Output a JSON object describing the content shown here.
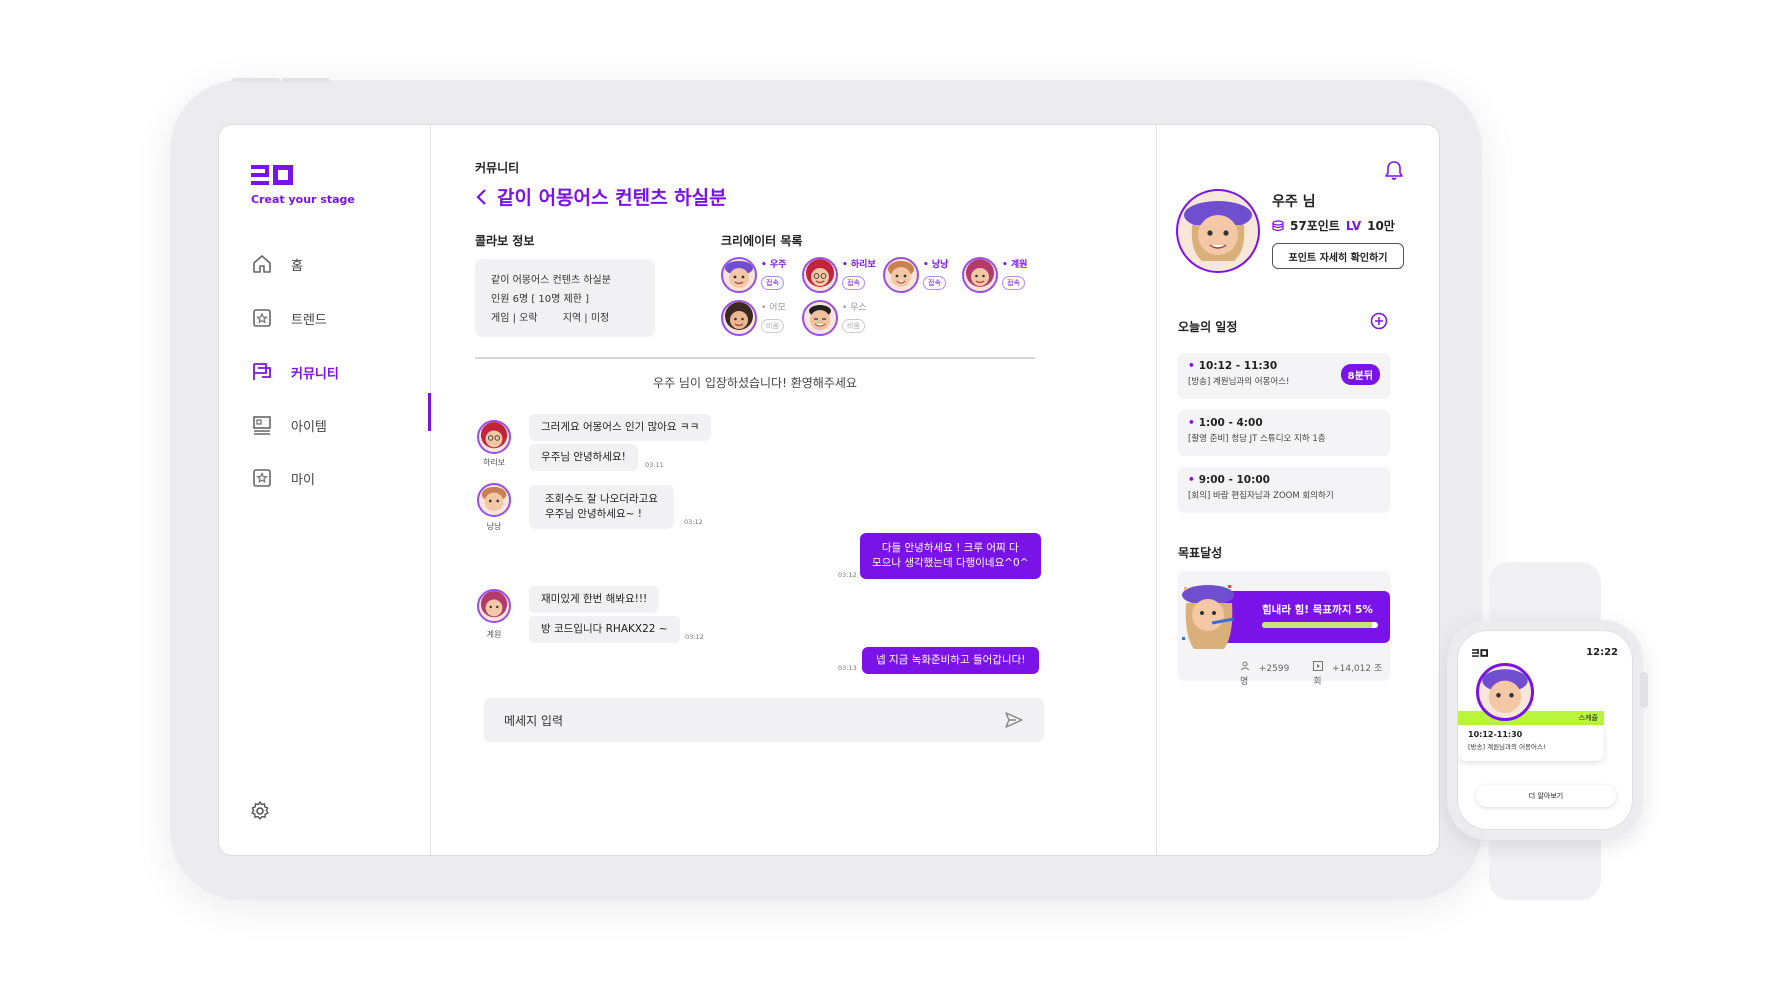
{
  "brand": {
    "tagline": "Creat your stage",
    "accent": "#7a13e8"
  },
  "sidebar": {
    "items": [
      {
        "label": "홈",
        "icon": "home-icon"
      },
      {
        "label": "트렌드",
        "icon": "trend-icon"
      },
      {
        "label": "커뮤니티",
        "icon": "community-icon",
        "active": true
      },
      {
        "label": "아이템",
        "icon": "item-icon"
      },
      {
        "label": "마이",
        "icon": "my-icon"
      }
    ],
    "settings_icon": "gear-icon"
  },
  "main": {
    "breadcrumb": "커뮤니티",
    "title": "같이 어몽어스 컨텐츠 하실분",
    "collab": {
      "title": "콜라보 정보",
      "line1": "같이 어몽어스 컨텐츠 하실분",
      "line2": "인원 6명 [ 10명 제한 ]",
      "line3a": "게임 | 오락",
      "line3b": "지역 | 미정"
    },
    "creators": {
      "title": "크리에이터 목록",
      "list": [
        {
          "name": "• 우주",
          "status": "접속"
        },
        {
          "name": "• 하리보",
          "status": "접속"
        },
        {
          "name": "• 낭낭",
          "status": "접속"
        },
        {
          "name": "• 계원",
          "status": "접속"
        },
        {
          "name": "• 어모",
          "status": "비움"
        },
        {
          "name": "• 우스",
          "status": "비움"
        }
      ]
    },
    "system_msg": "우주 님이 입장하셨습니다! 환영해주세요",
    "messages": [
      {
        "sender": "하리보",
        "text": "그러게요 어몽어스 인기 많아요 ㅋㅋ"
      },
      {
        "sender": "하리보",
        "text": "우주님 안녕하세요!",
        "time": "03:11"
      },
      {
        "sender": "낭낭",
        "text1": "조회수도 잘 나오더라고요",
        "text2": "우주님 안녕하세요~ !",
        "time": "03:12"
      },
      {
        "sender": "me",
        "text1": "다들 안녕하세요 ! 크루 어찌 다",
        "text2": "모으나 생각했는데 다행이네요^0^",
        "time": "03:12"
      },
      {
        "sender": "계원",
        "text": "재미있게 한번 해봐요!!!"
      },
      {
        "sender": "계원",
        "text": "방 코드입니다 RHAKX22 ~",
        "time": "03:12"
      },
      {
        "sender": "me",
        "text": "넵 지금 녹화준비하고 들어갑니다!",
        "time": "03:13"
      }
    ],
    "input_placeholder": "메세지 입력"
  },
  "right": {
    "user_name": "우주 님",
    "points": "57포인트",
    "level_label": "LV",
    "level_value": "10만",
    "points_button": "포인트 자세히 확인하기",
    "schedule_title": "오늘의 일정",
    "schedule": [
      {
        "time": "10:12 - 11:30",
        "desc": "[방송] 계원님과의 어몽어스!",
        "badge": "8분뒤"
      },
      {
        "time": "1:00 - 4:00",
        "desc": "[촬영 준비] 청담 JT 스튜디오 지하 1층"
      },
      {
        "time": "9:00 - 10:00",
        "desc": "[회의] 바람 편집자님과 ZOOM 회의하기"
      }
    ],
    "goal_title": "목표달성",
    "goal_text": "힘내라 힘! 목표까지 5%",
    "goal_progress": 0.95,
    "goal_followers": "+2599명",
    "goal_views": "+14,012 조회"
  },
  "watch": {
    "time": "12:22",
    "tag": "스케쥴",
    "event_time": "10:12-11:30",
    "event_desc": "[방송] 계원님과의 어몽어스!",
    "more": "더 알아보기"
  }
}
